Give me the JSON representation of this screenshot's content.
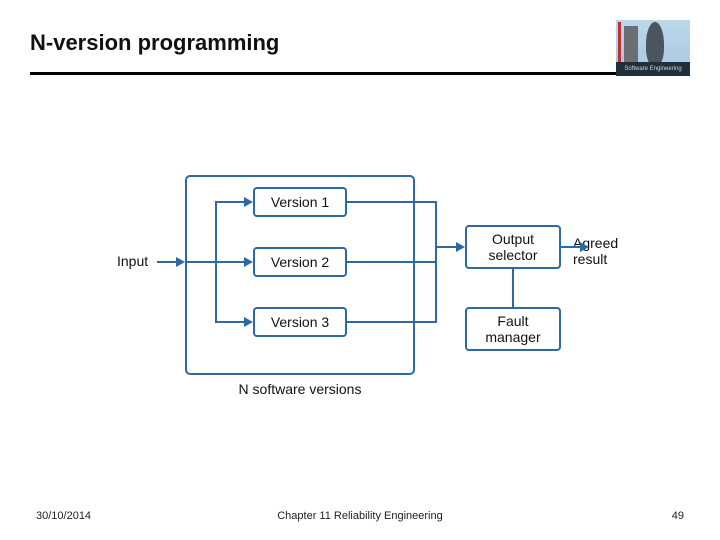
{
  "header": {
    "title": "N-version programming"
  },
  "logo": {
    "band_text": "Software Engineering"
  },
  "diagram": {
    "input_label": "Input",
    "outer_caption": "N software versions",
    "version1": "Version 1",
    "version2": "Version 2",
    "version3": "Version 3",
    "output_selector": "Output\nselector",
    "fault_manager": "Fault\nmanager",
    "agreed_result": "Agreed\nresult"
  },
  "footer": {
    "date": "30/10/2014",
    "chapter": "Chapter 11 Reliability Engineering",
    "page": "49"
  }
}
